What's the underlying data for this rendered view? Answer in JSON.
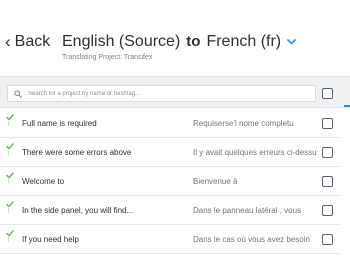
{
  "header": {
    "back_label": "Back",
    "source_language": "English (Source)",
    "connector": "to",
    "target_language": "French (fr)",
    "subtitle": "Translating Project: Transifex"
  },
  "search": {
    "placeholder": "Search for a project by name or hashtag..."
  },
  "rows": [
    {
      "source": "Full name is required",
      "translation": "Requiserse'l nome completu",
      "status": "translated"
    },
    {
      "source": "There were some errors above",
      "translation": "Il y avait quelques erreurs ci-dessus",
      "status": "translated"
    },
    {
      "source": "Welcome to",
      "translation": "Bienvenue à",
      "status": "translated"
    },
    {
      "source": "In the side panel, you will find...",
      "translation": "Dans le panneau latéral , vous",
      "status": "translated"
    },
    {
      "source": "If you need help",
      "translation": "Dans le cas où vous avez besoin",
      "status": "translated"
    }
  ],
  "colors": {
    "accent": "#2a8fd8",
    "status_check": "#6ab85f",
    "search_band": "#eef0f2"
  }
}
